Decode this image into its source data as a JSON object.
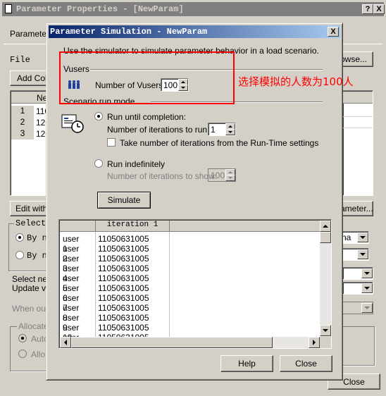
{
  "back_window": {
    "title": "Parameter Properties - [NewParam]",
    "tab_parameter": "Parameter",
    "file_label": "File",
    "browse_button": "owse...",
    "add_column_button": "Add Colu",
    "table_header": "Ne",
    "rows": [
      {
        "num": "1",
        "val": "110"
      },
      {
        "num": "2",
        "val": "120"
      },
      {
        "num": "3",
        "val": "120"
      }
    ],
    "edit_with_button": "Edit with",
    "parameter_button": "ameter...",
    "select_group": "Select",
    "radio_by_1": "By n",
    "radio_by_2": "By n",
    "select_next": "Select ne",
    "update_value": "Update va",
    "when_out": "When out",
    "allocate": "Allocate",
    "auto_label": "Auto",
    "alloc_label": "Allo",
    "combo_text": "na",
    "close_button": "Close",
    "help_symbol": "?",
    "close_symbol": "X"
  },
  "dialog": {
    "title": "Parameter Simulation - NewParam",
    "description": "Use the simulator to simulate parameter behavior in a load scenario.",
    "vusers_group": "Vusers",
    "num_vusers_label": "Number of Vusers:",
    "num_vusers_value": "100",
    "scenario_group": "Scenario run mode",
    "run_until_label": "Run until completion:",
    "iterations_label": "Number of iterations to run:",
    "iterations_value": "1",
    "take_number_label": "Take number of iterations from the Run-Time settings",
    "run_indef_label": "Run indefinitely",
    "iter_show_label": "Number of iterations to show:",
    "iter_show_value": "100",
    "simulate_button": "Simulate",
    "help_button": "Help",
    "close_button": "Close",
    "grid": {
      "column": "iteration 1",
      "rows": [
        {
          "user": "user 1",
          "value": "11050631005"
        },
        {
          "user": "user 2",
          "value": "11050631005"
        },
        {
          "user": "user 3",
          "value": "11050631005"
        },
        {
          "user": "user 4",
          "value": "11050631005"
        },
        {
          "user": "user 5",
          "value": "11050631005"
        },
        {
          "user": "user 6",
          "value": "11050631005"
        },
        {
          "user": "user 7",
          "value": "11050631005"
        },
        {
          "user": "user 8",
          "value": "11050631005"
        },
        {
          "user": "user 9",
          "value": "11050631005"
        },
        {
          "user": "user 10",
          "value": "11050631005"
        },
        {
          "user": "user 11",
          "value": "11050631005"
        }
      ]
    }
  },
  "annotation": {
    "text": "选择模拟的人数为100人",
    "color": "#ff0000"
  }
}
